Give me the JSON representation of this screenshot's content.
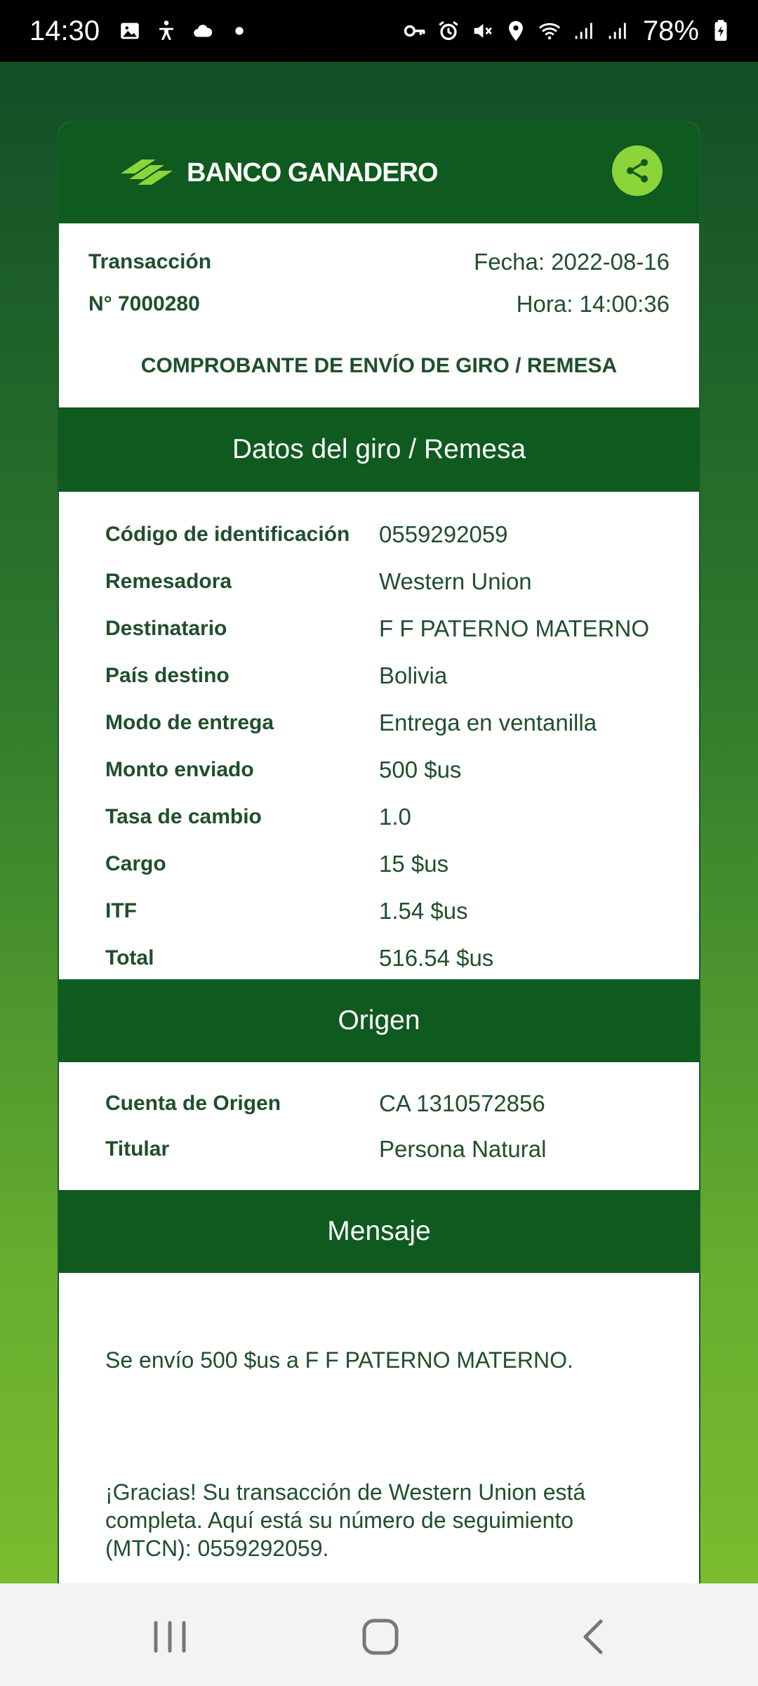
{
  "status_bar": {
    "time": "14:30",
    "battery": "78%",
    "left_icons": [
      "image-icon",
      "accessibility-icon",
      "cloud-icon",
      "dot-icon"
    ],
    "right_icons": [
      "key-icon",
      "alarm-icon",
      "mute-icon",
      "location-icon",
      "wifi-icon",
      "signal-icon",
      "signal-icon",
      "battery-icon"
    ]
  },
  "header": {
    "brand": "BANCO GANADERO",
    "share_icon": "share-icon",
    "brand_color": "#0f5a1f",
    "accent_color": "#8bd43a"
  },
  "transaction": {
    "label": "Transacción",
    "number": "N° 7000280",
    "date": "Fecha: 2022-08-16",
    "time": "Hora: 14:00:36"
  },
  "document_title": "COMPROBANTE DE ENVÍO DE GIRO / REMESA",
  "sections": {
    "giro": {
      "title": "Datos del giro / Remesa",
      "rows": [
        {
          "label": "Código de identificación",
          "value": "0559292059"
        },
        {
          "label": "Remesadora",
          "value": "Western Union"
        },
        {
          "label": "Destinatario",
          "value": "F F PATERNO MATERNO"
        },
        {
          "label": "País destino",
          "value": "Bolivia"
        },
        {
          "label": "Modo de entrega",
          "value": "Entrega en ventanilla"
        },
        {
          "label": "Monto enviado",
          "value": "500 $us"
        },
        {
          "label": "Tasa de cambio",
          "value": "1.0"
        },
        {
          "label": "Cargo",
          "value": "15 $us"
        },
        {
          "label": "ITF",
          "value": "1.54 $us"
        },
        {
          "label": "Total",
          "value": "516.54 $us"
        }
      ]
    },
    "origen": {
      "title": "Origen",
      "rows": [
        {
          "label": "Cuenta de Origen",
          "value": "CA 1310572856"
        },
        {
          "label": "Titular",
          "value": "Persona Natural"
        }
      ]
    },
    "mensaje": {
      "title": "Mensaje",
      "line1": "Se envío 500 $us a F F PATERNO MATERNO.",
      "line2": "¡Gracias! Su transacción de Western Union está completa. Aquí está su número de seguimiento (MTCN): 0559292059."
    }
  },
  "nav_bar": {
    "icons": [
      "recent-apps-icon",
      "home-icon",
      "back-icon"
    ]
  }
}
